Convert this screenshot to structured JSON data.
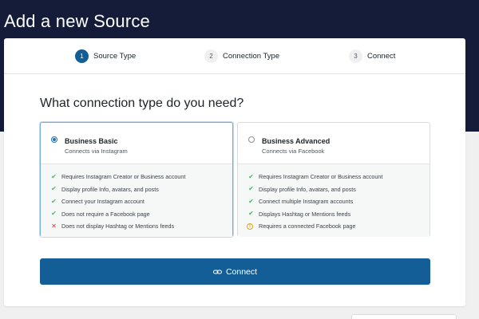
{
  "page": {
    "title": "Add a new Source"
  },
  "stepper": {
    "steps": [
      {
        "number": "1",
        "label": "Source Type",
        "state": "active"
      },
      {
        "number": "2",
        "label": "Connection Type",
        "state": "inactive"
      },
      {
        "number": "3",
        "label": "Connect",
        "state": "inactive"
      }
    ]
  },
  "question": "What connection type do you need?",
  "options": [
    {
      "title": "Business Basic",
      "subtitle": "Connects via Instagram",
      "selected": true,
      "features": [
        {
          "icon": "check-icon",
          "text": "Requires Instagram Creator or Business account"
        },
        {
          "icon": "check-icon",
          "text": "Display profile Info, avatars, and posts"
        },
        {
          "icon": "check-icon",
          "text": "Connect your Instagram account"
        },
        {
          "icon": "check-icon",
          "text": "Does not require a Facebook page"
        },
        {
          "icon": "cross-icon",
          "text": "Does not display Hashtag or Mentions feeds"
        }
      ]
    },
    {
      "title": "Business Advanced",
      "subtitle": "Connects via Facebook",
      "selected": false,
      "features": [
        {
          "icon": "check-icon",
          "text": "Requires Instagram Creator or Business account"
        },
        {
          "icon": "check-icon",
          "text": "Display profile Info, avatars, and posts"
        },
        {
          "icon": "check-icon",
          "text": "Connect multiple Instagram accounts"
        },
        {
          "icon": "check-icon",
          "text": "Displays Hashtag or Mentions feeds"
        },
        {
          "icon": "info-icon",
          "text": "Requires a connected Facebook page"
        }
      ]
    }
  ],
  "connect_button": {
    "label": "Connect",
    "icon": "link-icon"
  },
  "colors": {
    "header_bg": "#141c3a",
    "primary": "#135e96",
    "check": "#4ab866",
    "cross": "#d63638",
    "warning": "#dba617"
  }
}
